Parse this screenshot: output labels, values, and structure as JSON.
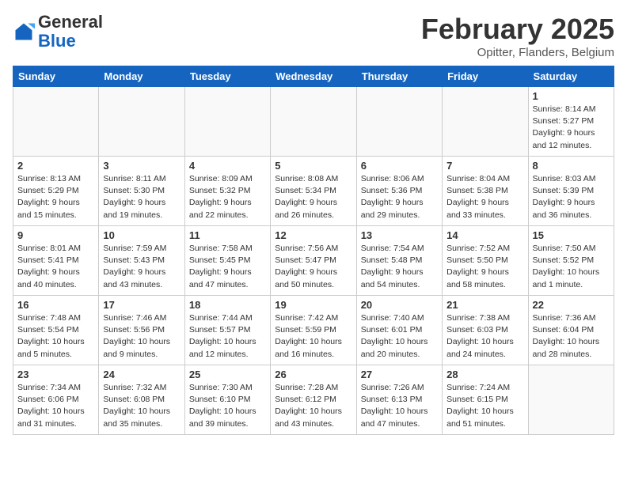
{
  "header": {
    "logo": {
      "general": "General",
      "blue": "Blue"
    },
    "title": "February 2025",
    "location": "Opitter, Flanders, Belgium"
  },
  "weekdays": [
    "Sunday",
    "Monday",
    "Tuesday",
    "Wednesday",
    "Thursday",
    "Friday",
    "Saturday"
  ],
  "weeks": [
    [
      {
        "day": "",
        "info": ""
      },
      {
        "day": "",
        "info": ""
      },
      {
        "day": "",
        "info": ""
      },
      {
        "day": "",
        "info": ""
      },
      {
        "day": "",
        "info": ""
      },
      {
        "day": "",
        "info": ""
      },
      {
        "day": "1",
        "info": "Sunrise: 8:14 AM\nSunset: 5:27 PM\nDaylight: 9 hours and 12 minutes."
      }
    ],
    [
      {
        "day": "2",
        "info": "Sunrise: 8:13 AM\nSunset: 5:29 PM\nDaylight: 9 hours and 15 minutes."
      },
      {
        "day": "3",
        "info": "Sunrise: 8:11 AM\nSunset: 5:30 PM\nDaylight: 9 hours and 19 minutes."
      },
      {
        "day": "4",
        "info": "Sunrise: 8:09 AM\nSunset: 5:32 PM\nDaylight: 9 hours and 22 minutes."
      },
      {
        "day": "5",
        "info": "Sunrise: 8:08 AM\nSunset: 5:34 PM\nDaylight: 9 hours and 26 minutes."
      },
      {
        "day": "6",
        "info": "Sunrise: 8:06 AM\nSunset: 5:36 PM\nDaylight: 9 hours and 29 minutes."
      },
      {
        "day": "7",
        "info": "Sunrise: 8:04 AM\nSunset: 5:38 PM\nDaylight: 9 hours and 33 minutes."
      },
      {
        "day": "8",
        "info": "Sunrise: 8:03 AM\nSunset: 5:39 PM\nDaylight: 9 hours and 36 minutes."
      }
    ],
    [
      {
        "day": "9",
        "info": "Sunrise: 8:01 AM\nSunset: 5:41 PM\nDaylight: 9 hours and 40 minutes."
      },
      {
        "day": "10",
        "info": "Sunrise: 7:59 AM\nSunset: 5:43 PM\nDaylight: 9 hours and 43 minutes."
      },
      {
        "day": "11",
        "info": "Sunrise: 7:58 AM\nSunset: 5:45 PM\nDaylight: 9 hours and 47 minutes."
      },
      {
        "day": "12",
        "info": "Sunrise: 7:56 AM\nSunset: 5:47 PM\nDaylight: 9 hours and 50 minutes."
      },
      {
        "day": "13",
        "info": "Sunrise: 7:54 AM\nSunset: 5:48 PM\nDaylight: 9 hours and 54 minutes."
      },
      {
        "day": "14",
        "info": "Sunrise: 7:52 AM\nSunset: 5:50 PM\nDaylight: 9 hours and 58 minutes."
      },
      {
        "day": "15",
        "info": "Sunrise: 7:50 AM\nSunset: 5:52 PM\nDaylight: 10 hours and 1 minute."
      }
    ],
    [
      {
        "day": "16",
        "info": "Sunrise: 7:48 AM\nSunset: 5:54 PM\nDaylight: 10 hours and 5 minutes."
      },
      {
        "day": "17",
        "info": "Sunrise: 7:46 AM\nSunset: 5:56 PM\nDaylight: 10 hours and 9 minutes."
      },
      {
        "day": "18",
        "info": "Sunrise: 7:44 AM\nSunset: 5:57 PM\nDaylight: 10 hours and 12 minutes."
      },
      {
        "day": "19",
        "info": "Sunrise: 7:42 AM\nSunset: 5:59 PM\nDaylight: 10 hours and 16 minutes."
      },
      {
        "day": "20",
        "info": "Sunrise: 7:40 AM\nSunset: 6:01 PM\nDaylight: 10 hours and 20 minutes."
      },
      {
        "day": "21",
        "info": "Sunrise: 7:38 AM\nSunset: 6:03 PM\nDaylight: 10 hours and 24 minutes."
      },
      {
        "day": "22",
        "info": "Sunrise: 7:36 AM\nSunset: 6:04 PM\nDaylight: 10 hours and 28 minutes."
      }
    ],
    [
      {
        "day": "23",
        "info": "Sunrise: 7:34 AM\nSunset: 6:06 PM\nDaylight: 10 hours and 31 minutes."
      },
      {
        "day": "24",
        "info": "Sunrise: 7:32 AM\nSunset: 6:08 PM\nDaylight: 10 hours and 35 minutes."
      },
      {
        "day": "25",
        "info": "Sunrise: 7:30 AM\nSunset: 6:10 PM\nDaylight: 10 hours and 39 minutes."
      },
      {
        "day": "26",
        "info": "Sunrise: 7:28 AM\nSunset: 6:12 PM\nDaylight: 10 hours and 43 minutes."
      },
      {
        "day": "27",
        "info": "Sunrise: 7:26 AM\nSunset: 6:13 PM\nDaylight: 10 hours and 47 minutes."
      },
      {
        "day": "28",
        "info": "Sunrise: 7:24 AM\nSunset: 6:15 PM\nDaylight: 10 hours and 51 minutes."
      },
      {
        "day": "",
        "info": ""
      }
    ]
  ]
}
